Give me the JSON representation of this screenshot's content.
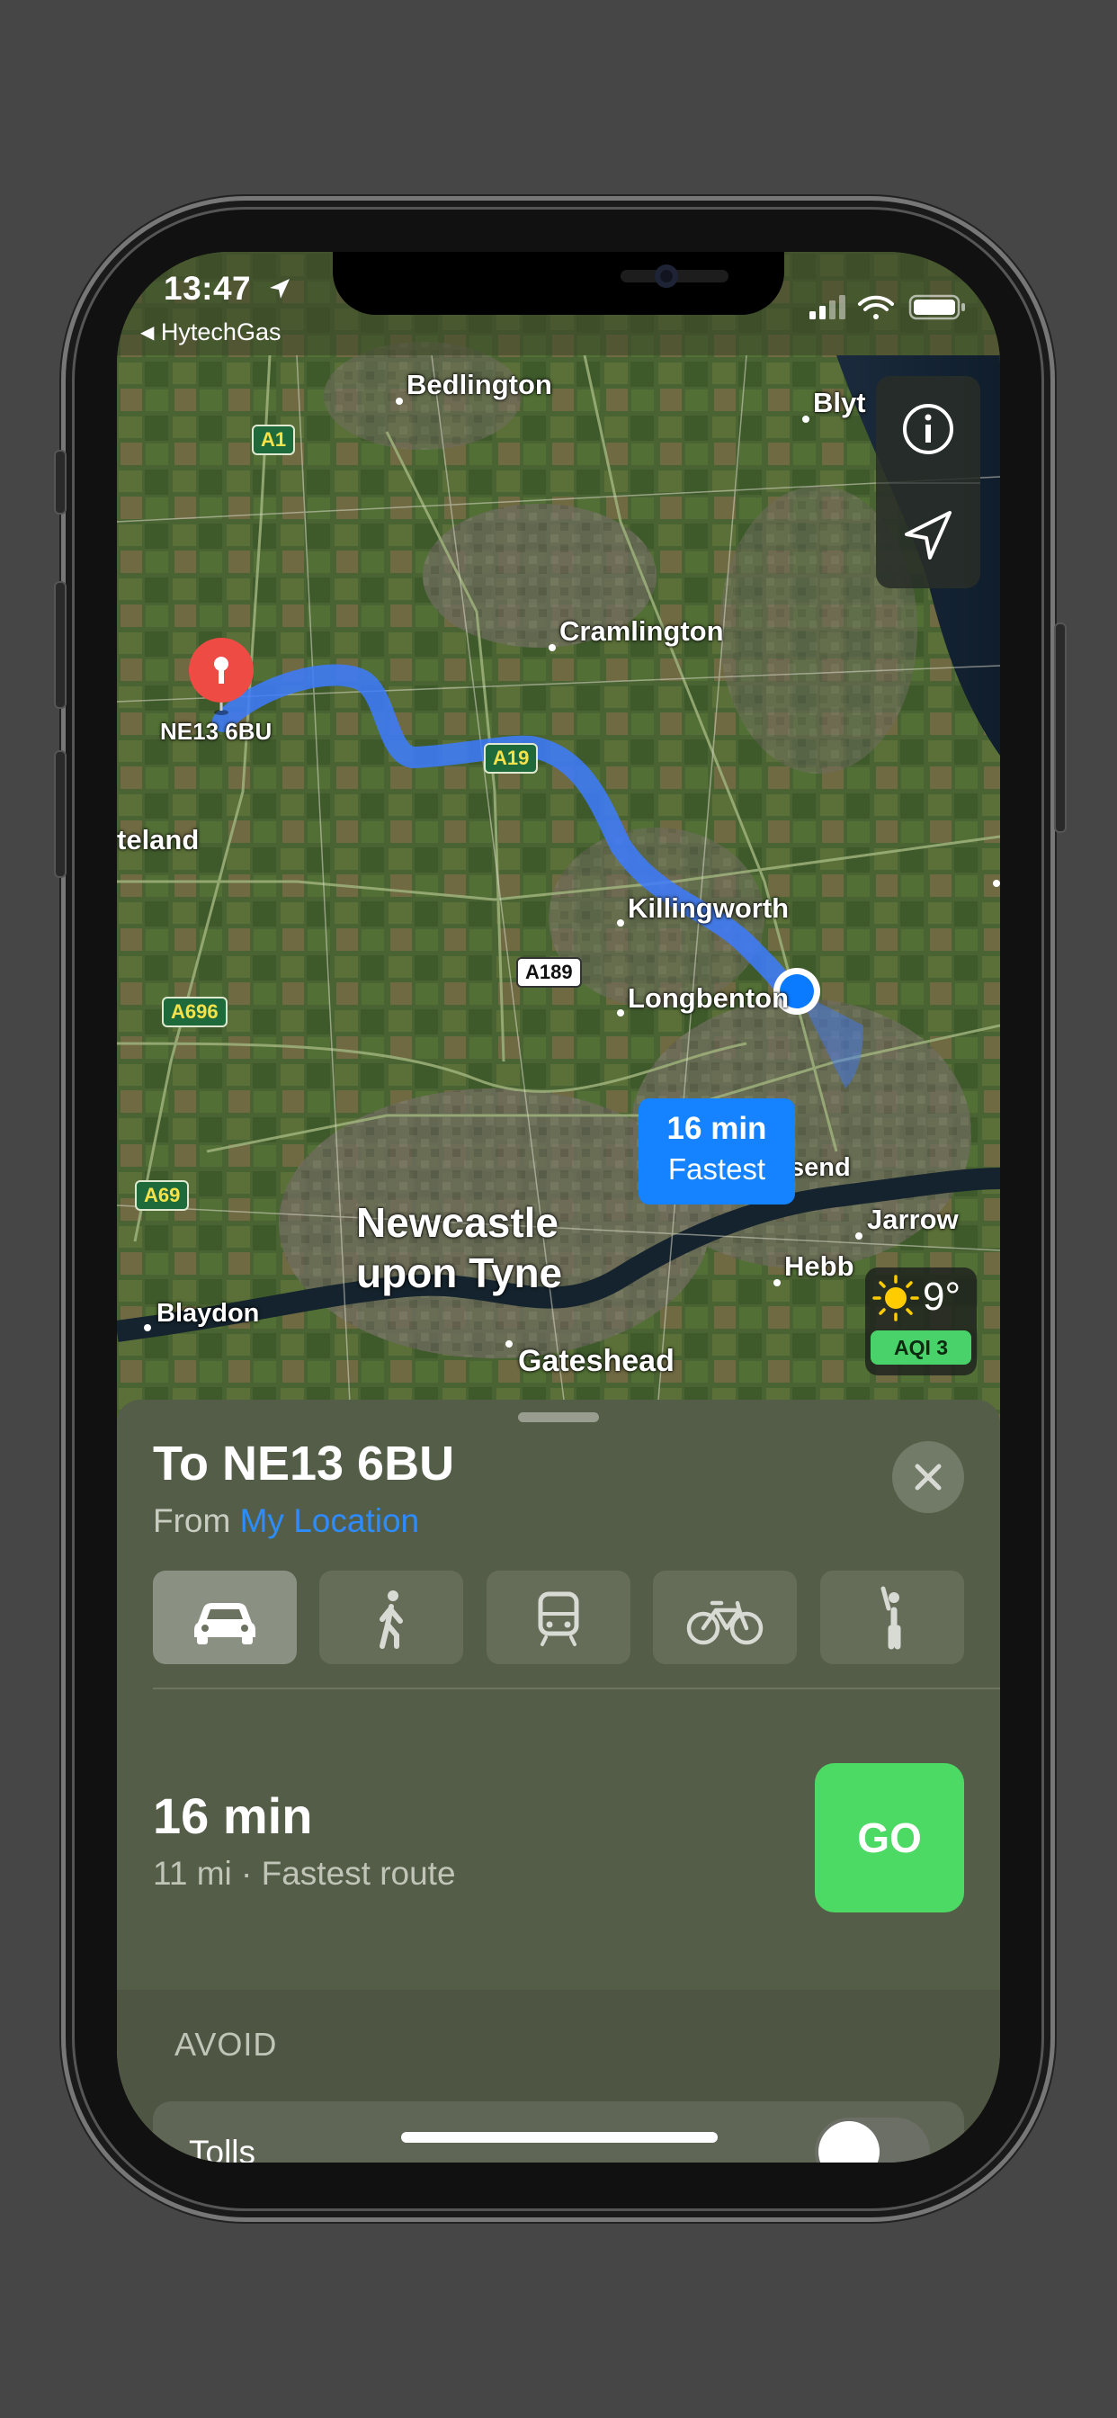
{
  "status_bar": {
    "time": "13:47",
    "back_app": "HytechGas"
  },
  "map": {
    "places": [
      "Bedlington",
      "Blyt",
      "Cramlington",
      "teland",
      "Killingworth",
      "Longbenton",
      "Newcastle",
      "upon Tyne",
      "send",
      "Jarrow",
      "Blaydon",
      "Hebb",
      "Gateshead"
    ],
    "roads": [
      "A1",
      "A19",
      "A189",
      "A696",
      "A69"
    ],
    "destination_pin_label": "NE13 6BU",
    "route_callout": {
      "time": "16 min",
      "label": "Fastest"
    },
    "weather": {
      "temperature": "9°",
      "aqi": "AQI 3"
    },
    "controls": [
      "info-icon",
      "location-arrow-icon"
    ]
  },
  "sheet": {
    "title": "To NE13 6BU",
    "from_prefix": "From",
    "from_location": "My Location",
    "transport_modes": [
      "car-icon",
      "walking-icon",
      "transit-icon",
      "bicycle-icon",
      "rideshare-icon"
    ],
    "selected_mode": "car-icon",
    "route": {
      "time": "16 min",
      "detail": "11 mi · Fastest route",
      "go_label": "GO"
    },
    "avoid_header": "AVOID",
    "avoid_items": [
      {
        "label": "Tolls",
        "enabled": false
      }
    ]
  },
  "colors": {
    "route": "#3d7bff",
    "accent_link": "#2d8cff",
    "go_button": "#4cd964",
    "pin": "#ef4b45",
    "aqi_badge": "#49d26a"
  }
}
